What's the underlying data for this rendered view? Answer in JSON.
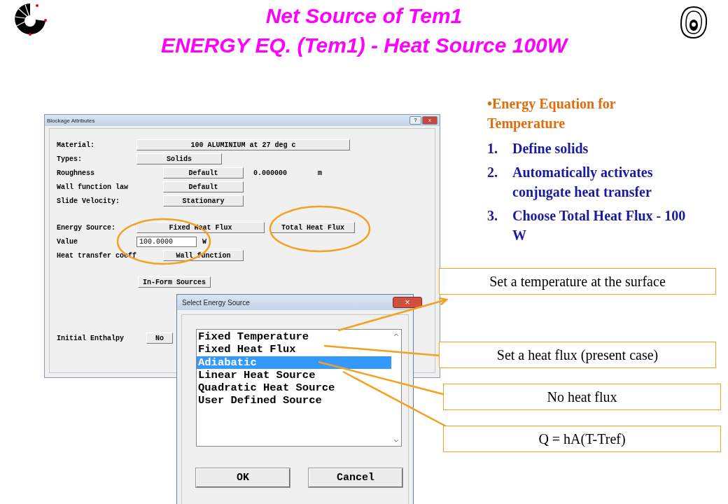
{
  "title_lines": [
    "Net Source of Tem1",
    "ENERGY EQ. (Tem1) - Heat Source 100W"
  ],
  "notes": {
    "heading": "•Energy Equation for Temperature",
    "items": [
      {
        "number": "1.",
        "text": "Define solids"
      },
      {
        "number": "2.",
        "text": "Automatically activates conjugate heat transfer"
      },
      {
        "number": "3.",
        "text": "Choose Total Heat Flux - 100 W"
      }
    ]
  },
  "blockage_dialog": {
    "title": "Blockage Attributes",
    "help": "?",
    "close": "x",
    "groups": [
      [
        {
          "kind": "picker",
          "label": "Material:",
          "buttons": [
            "100 ALUMINIUM at 27 deg c"
          ]
        },
        {
          "kind": "picker",
          "label": "Types:",
          "buttons": [
            "Solids"
          ]
        },
        {
          "kind": "setting",
          "label": "Roughness",
          "buttons": [
            "Default"
          ],
          "value": "0.000000",
          "unit": "m"
        },
        {
          "kind": "setting",
          "label": "Wall function law",
          "buttons": [
            "Default"
          ]
        },
        {
          "kind": "setting",
          "label": "Slide Velocity:",
          "buttons": [
            "Stationary"
          ]
        }
      ],
      [
        {
          "kind": "picker",
          "label": "Energy Source:",
          "buttons": [
            "Fixed Heat Flux",
            "Total Heat Flux"
          ]
        },
        {
          "kind": "entry",
          "label": "Value",
          "value": "100.0000",
          "unit": "W"
        },
        {
          "kind": "setting",
          "label": "Heat transfer coeff",
          "buttons": [
            "Wall function"
          ]
        }
      ]
    ],
    "inform_button": "In-Form Sources",
    "initial_enthalpy": {
      "label": "Initial Enthalpy",
      "button": "No"
    }
  },
  "select_dialog": {
    "title": "Select Energy Source",
    "close": "×",
    "options": [
      {
        "label": "Fixed Temperature",
        "selected": false
      },
      {
        "label": "Fixed Heat Flux",
        "selected": false
      },
      {
        "label": "Adiabatic",
        "selected": true
      },
      {
        "label": "Linear Heat Source",
        "selected": false
      },
      {
        "label": "Quadratic Heat Source",
        "selected": false
      },
      {
        "label": "User Defined Source",
        "selected": false
      }
    ],
    "buttons": [
      "OK",
      "Cancel"
    ]
  },
  "callouts": [
    "Set a temperature at the surface",
    "Set a heat flux (present case)",
    "No heat flux",
    "Q = hA(T-Tref)"
  ]
}
